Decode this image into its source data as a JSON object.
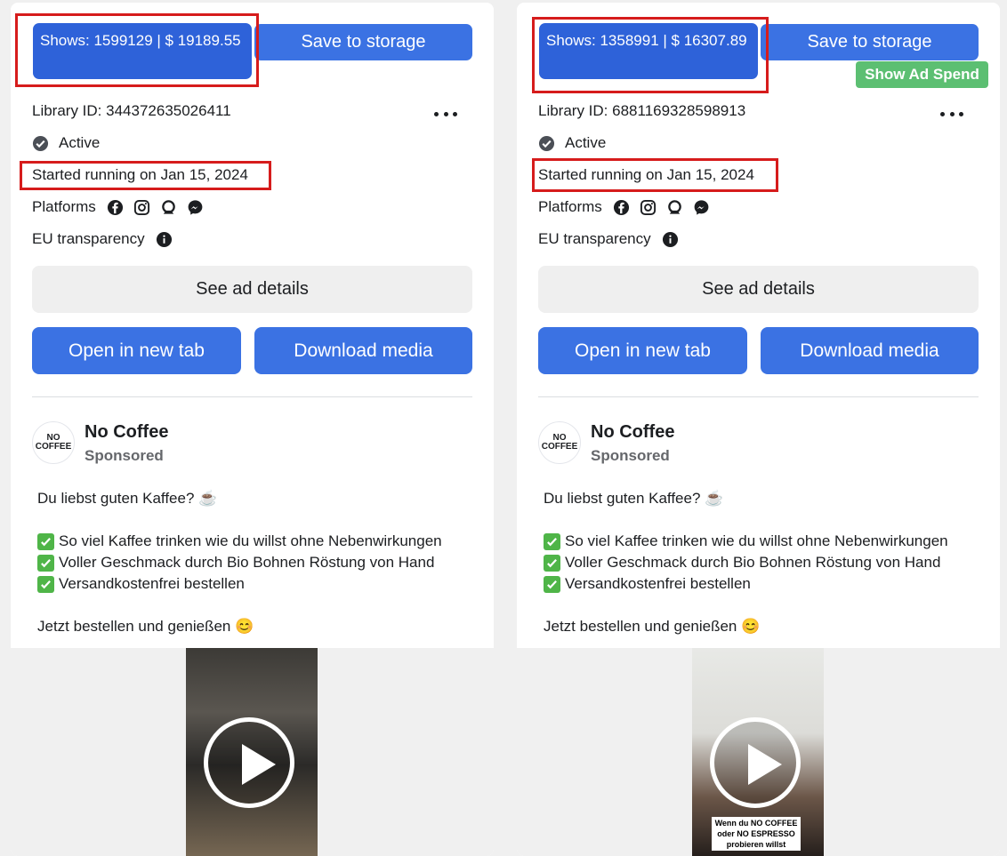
{
  "cards": [
    {
      "shows": "Shows: 1599129 | $ 19189.55",
      "save_label": "Save to storage",
      "library_id": "Library ID: 344372635026411",
      "status": "Active",
      "started": "Started running on Jan 15, 2024",
      "platforms_label": "Platforms",
      "eu_label": "EU transparency",
      "details_label": "See ad details",
      "open_label": "Open in new tab",
      "download_label": "Download media",
      "avatar_line1": "NO",
      "avatar_line2": "COFFEE",
      "page_name": "No Coffee",
      "sponsored": "Sponsored",
      "body_intro": "Du liebst guten Kaffee? ☕",
      "bullets": [
        "So viel Kaffee trinken wie du willst ohne Nebenwirkungen",
        "Voller Geschmack durch Bio Bohnen Röstung von Hand",
        "Versandkostenfrei bestellen"
      ],
      "cta": "Jetzt bestellen und genießen 😊"
    },
    {
      "shows": "Shows: 1358991 | $ 16307.89",
      "save_label": "Save to storage",
      "spend_label": "Show Ad Spend",
      "library_id": "Library ID: 6881169328598913",
      "status": "Active",
      "started": "Started running on Jan 15, 2024",
      "platforms_label": "Platforms",
      "eu_label": "EU transparency",
      "details_label": "See ad details",
      "open_label": "Open in new tab",
      "download_label": "Download media",
      "avatar_line1": "NO",
      "avatar_line2": "COFFEE",
      "page_name": "No Coffee",
      "sponsored": "Sponsored",
      "body_intro": "Du liebst guten Kaffee? ☕",
      "bullets": [
        "So viel Kaffee trinken wie du willst ohne Nebenwirkungen",
        "Voller Geschmack durch Bio Bohnen Röstung von Hand",
        "Versandkostenfrei bestellen"
      ],
      "cta": "Jetzt bestellen und genießen 😊",
      "video_caption": "Wenn du NO COFFEE oder NO ESPRESSO probieren willst"
    }
  ],
  "colors": {
    "primary": "#3b72e3",
    "highlight": "#d61c1c",
    "spend": "#5cbf72",
    "check": "#4fb548"
  }
}
